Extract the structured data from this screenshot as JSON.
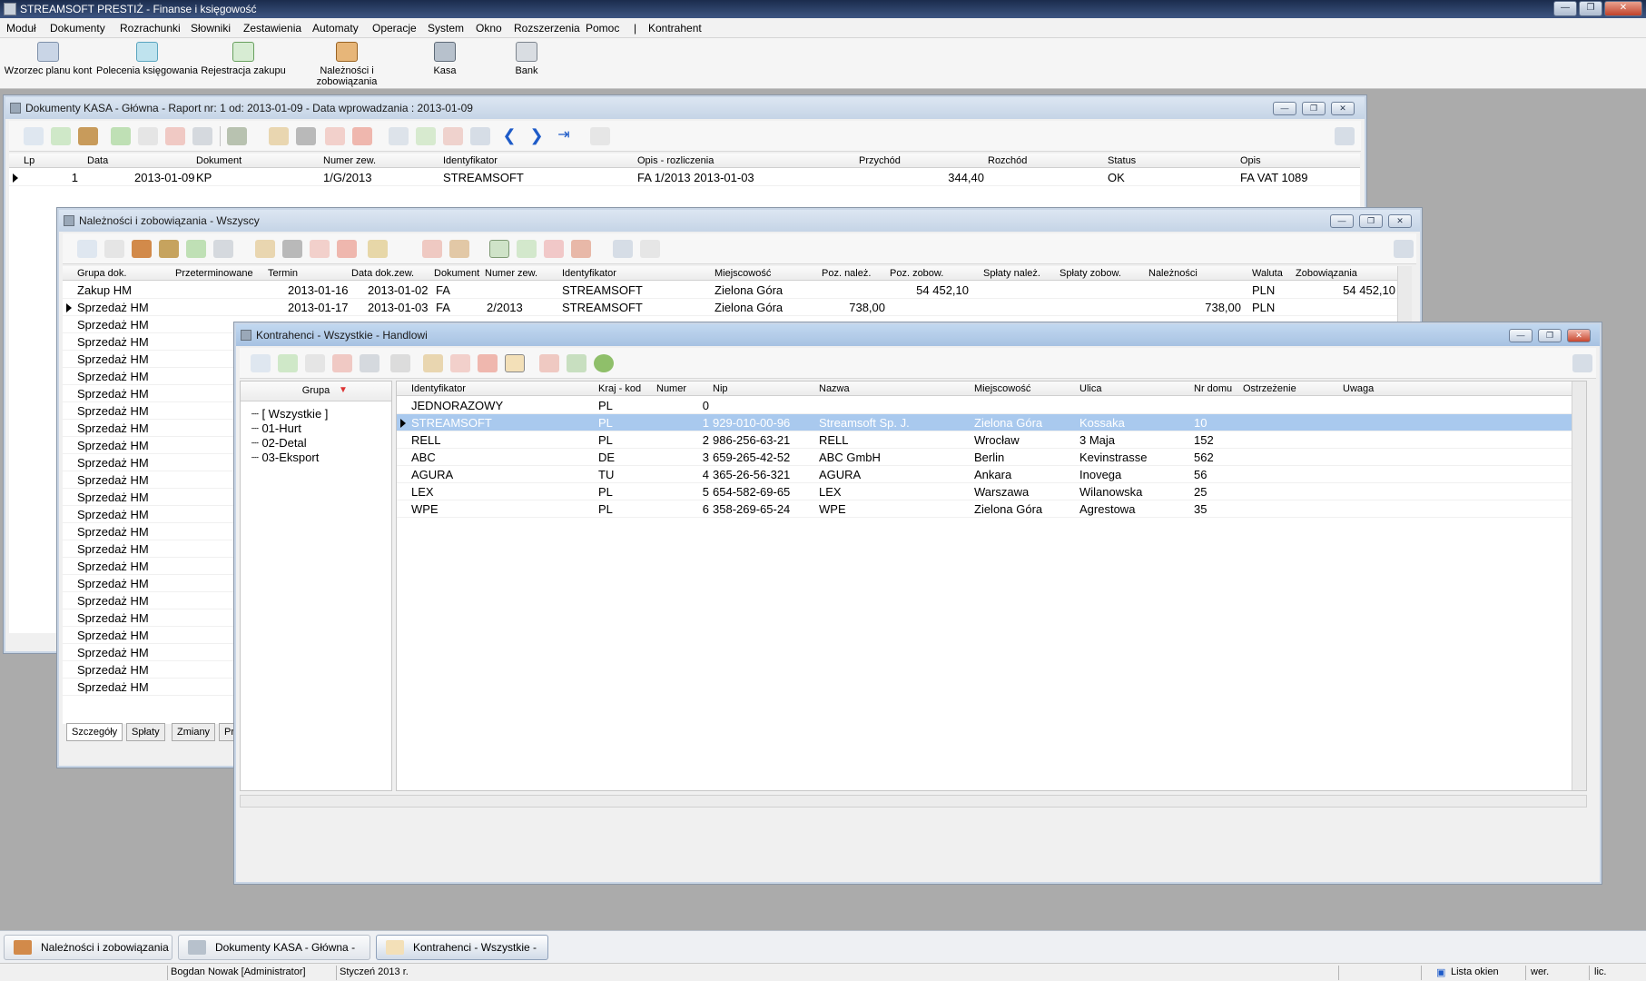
{
  "app": {
    "title": "STREAMSOFT PRESTIŻ - Finanse i księgowość"
  },
  "menu": [
    "Moduł",
    "Dokumenty",
    "Rozrachunki",
    "Słowniki",
    "Zestawienia",
    "Automaty",
    "Operacje",
    "System",
    "Okno",
    "Rozszerzenia",
    "Pomoc",
    "|",
    "Kontrahent"
  ],
  "toolbar": [
    "Wzorzec planu kont",
    "Polecenia księgowania",
    "Rejestracja zakupu",
    "Należności i zobowiązania",
    "Kasa",
    "Bank"
  ],
  "win_kasa": {
    "title": "Dokumenty KASA - Główna - Raport nr: 1 od: 2013-01-09 - Data wprowadzania : 2013-01-09",
    "columns": [
      "Lp",
      "Data",
      "Dokument",
      "Numer zew.",
      "Identyfikator",
      "Opis - rozliczenia",
      "Przychód",
      "Rozchód",
      "Status",
      "Opis"
    ],
    "rows": [
      {
        "lp": "1",
        "data": "2013-01-09",
        "dok": "KP",
        "nr": "1/G/2013",
        "ident": "STREAMSOFT",
        "opis_rozl": "FA 1/2013 2013-01-03",
        "przychod": "344,40",
        "rozchod": "",
        "status": "OK",
        "opis": "FA VAT 1089"
      }
    ]
  },
  "win_nal": {
    "title": "Należności i zobowiązania - Wszyscy",
    "columns": [
      "Grupa dok.",
      "Przeterminowane",
      "Termin",
      "Data dok.zew.",
      "Dokument",
      "Numer zew.",
      "Identyfikator",
      "Miejscowość",
      "Poz. należ.",
      "Poz. zobow.",
      "Spłaty należ.",
      "Spłaty zobow.",
      "Należności",
      "Waluta",
      "Zobowiązania"
    ],
    "rows": [
      {
        "grupa": "Zakup HM",
        "termin": "2013-01-16",
        "data": "2013-01-02",
        "dok": "FA",
        "nr": "",
        "ident": "STREAMSOFT",
        "miejsc": "Zielona Góra",
        "poz_nal": "",
        "poz_zob": "54 452,10",
        "nal": "",
        "waluta": "PLN",
        "zob": "54 452,10"
      },
      {
        "grupa": "Sprzedaż HM",
        "termin": "2013-01-17",
        "data": "2013-01-03",
        "dok": "FA",
        "nr": "2/2013",
        "ident": "STREAMSOFT",
        "miejsc": "Zielona Góra",
        "poz_nal": "738,00",
        "poz_zob": "",
        "nal": "738,00",
        "waluta": "PLN",
        "zob": ""
      }
    ],
    "extra_group": "Sprzedaż HM",
    "tabs": [
      "Szczegóły",
      "Spłaty",
      "Zmiany",
      "Przele"
    ]
  },
  "win_kontr": {
    "title": "Kontrahenci - Wszystkie - Handlowi",
    "group_header": "Grupa",
    "groups": [
      "[ Wszystkie ]",
      "01-Hurt",
      "02-Detal",
      "03-Eksport"
    ],
    "columns": [
      "Identyfikator",
      "Kraj - kod",
      "Numer",
      "Nip",
      "Nazwa",
      "Miejscowość",
      "Ulica",
      "Nr domu",
      "Ostrzeżenie",
      "Uwaga"
    ],
    "rows": [
      {
        "ident": "JEDNORAZOWY",
        "kraj": "PL",
        "num": "0",
        "nip": "",
        "nazwa": "",
        "miejsc": "",
        "ulica": "",
        "nr": ""
      },
      {
        "ident": "STREAMSOFT",
        "kraj": "PL",
        "num": "1",
        "nip": "929-010-00-96",
        "nazwa": "Streamsoft Sp. J.",
        "miejsc": "Zielona Góra",
        "ulica": "Kossaka",
        "nr": "10"
      },
      {
        "ident": "RELL",
        "kraj": "PL",
        "num": "2",
        "nip": "986-256-63-21",
        "nazwa": "RELL",
        "miejsc": "Wrocław",
        "ulica": "3 Maja",
        "nr": "152"
      },
      {
        "ident": "ABC",
        "kraj": "DE",
        "num": "3",
        "nip": "659-265-42-52",
        "nazwa": "ABC GmbH",
        "miejsc": "Berlin",
        "ulica": "Kevinstrasse",
        "nr": "562"
      },
      {
        "ident": "AGURA",
        "kraj": "TU",
        "num": "4",
        "nip": "365-26-56-321",
        "nazwa": "AGURA",
        "miejsc": "Ankara",
        "ulica": "Inovega",
        "nr": "56"
      },
      {
        "ident": "LEX",
        "kraj": "PL",
        "num": "5",
        "nip": "654-582-69-65",
        "nazwa": "LEX",
        "miejsc": "Warszawa",
        "ulica": "Wilanowska",
        "nr": "25"
      },
      {
        "ident": "WPE",
        "kraj": "PL",
        "num": "6",
        "nip": "358-269-65-24",
        "nazwa": "WPE",
        "miejsc": "Zielona Góra",
        "ulica": "Agrestowa",
        "nr": "35"
      }
    ]
  },
  "taskbar": [
    "Należności i zobowiązania - ...",
    "Dokumenty KASA - Główna - Ra...",
    "Kontrahenci - Wszystkie - Ha..."
  ],
  "status": {
    "user": "Bogdan Nowak [Administrator]",
    "period": "Styczeń 2013 r.",
    "windows": "Lista okien",
    "ver": "wer.",
    "lic": "lic."
  },
  "colors": {
    "selection": "#a9c9ee",
    "title_active": "#a7c2e2",
    "accent_blue": "#1e5bc8"
  }
}
